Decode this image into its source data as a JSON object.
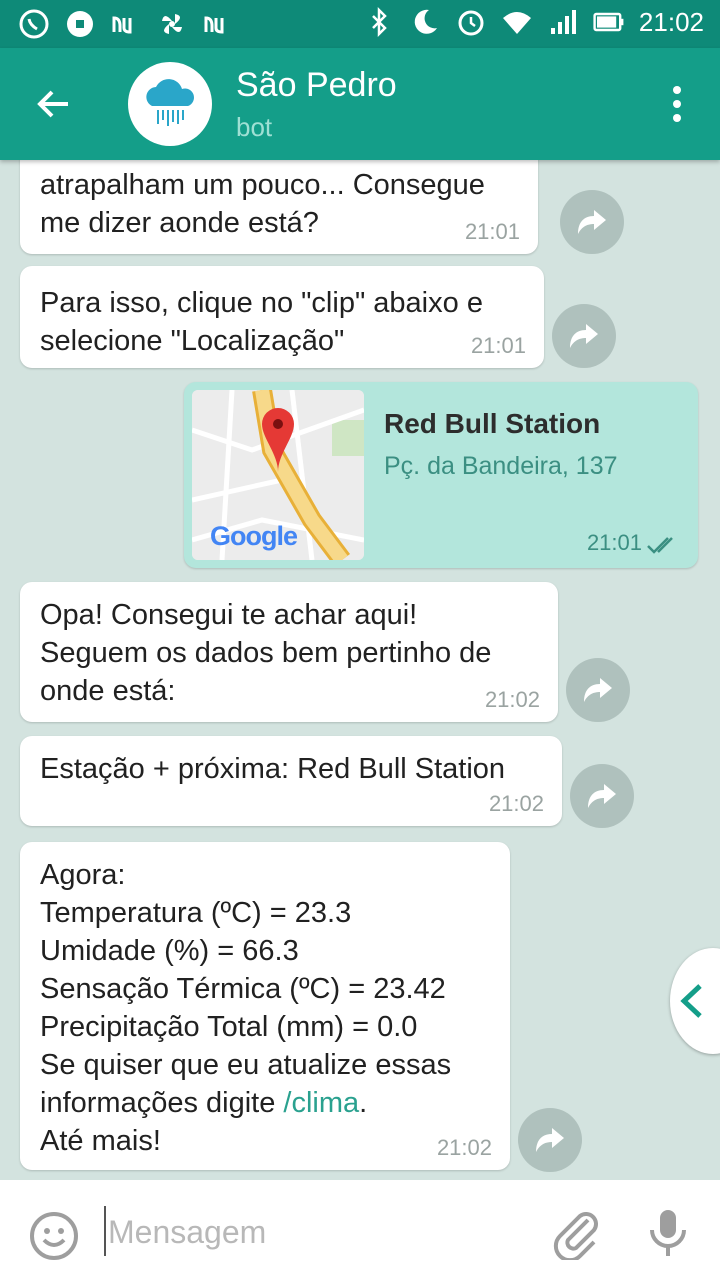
{
  "status_bar": {
    "time": "21:02"
  },
  "header": {
    "title": "São Pedro",
    "subtitle": "bot"
  },
  "messages": [
    {
      "lines": [
        "atrapalham um pouco... Consegue",
        "me dizer aonde está?"
      ],
      "time": "21:01"
    },
    {
      "lines": [
        "Para isso, clique no \"clip\" abaixo e",
        "selecione \"Localização\""
      ],
      "time": "21:01"
    },
    {
      "lines": [
        "Opa! Consegui te achar aqui!",
        "Seguem os dados bem pertinho de",
        "onde está:"
      ],
      "time": "21:02"
    },
    {
      "lines": [
        "Estação + próxima: Red Bull Station"
      ],
      "time": "21:02"
    },
    {
      "lines": [
        "Agora:",
        "Temperatura (ºC) = 23.3",
        "Umidade (%) = 66.3",
        "Sensação Térmica (ºC) = 23.42",
        "Precipitação Total (mm) = 0.0",
        "Se quiser que eu atualize essas"
      ],
      "line_pre": "informações digite ",
      "command": "/clima",
      "line_post": ".",
      "last_line": "Até mais!",
      "time": "21:02"
    }
  ],
  "location": {
    "name": "Red Bull Station",
    "address": "Pç. da Bandeira, 137",
    "time": "21:01",
    "map_brand": "Google"
  },
  "composer": {
    "placeholder": "Mensagem"
  },
  "colors": {
    "header": "#149e89",
    "status_bar": "#0e8a78",
    "outgoing_bubble": "#b3e6dc",
    "link": "#2aa18f"
  }
}
